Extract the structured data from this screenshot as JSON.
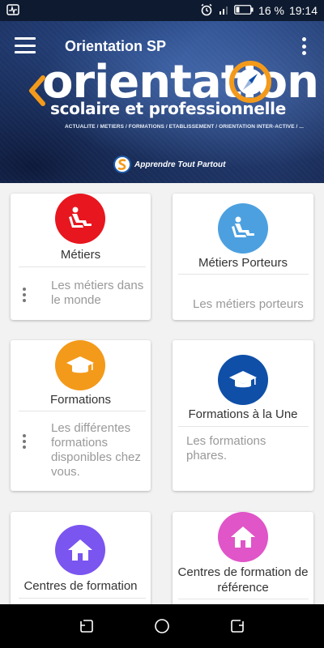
{
  "status_bar": {
    "battery_text": "16 %",
    "time": "19:14",
    "icons": [
      "activity-icon",
      "alarm-icon",
      "signal-icon",
      "battery-icon"
    ]
  },
  "toolbar": {
    "title": "Orientation SP",
    "menu_icon": "hamburger-menu-icon",
    "more_icon": "overflow-menu-icon"
  },
  "banner": {
    "title": "orientation",
    "subtitle": "scolaire et professionnelle",
    "tags": "ACTUALITE / METIERS / FORMATIONS / ETABLISSEMENT / ORIENTATION INTER-ACTIVE / ...",
    "slogan": "Apprendre Tout Partout"
  },
  "cards": [
    {
      "title": "Métiers",
      "description": "Les métiers dans le monde",
      "icon": "seat-icon",
      "color": "#e8161e",
      "has_menu": true
    },
    {
      "title": "Métiers Porteurs",
      "description": "Les métiers porteurs",
      "icon": "seat-icon",
      "color": "#4ca0e0",
      "has_menu": false
    },
    {
      "title": "Formations",
      "description": "Les différentes formations disponibles chez vous.",
      "icon": "graduation-cap-icon",
      "color": "#f39a1b",
      "has_menu": true
    },
    {
      "title": "Formations à la Une",
      "description": "Les  formations phares.",
      "icon": "graduation-cap-icon",
      "color": "#0f4fa8",
      "has_menu": false
    },
    {
      "title": "Centres de formation",
      "description": "",
      "icon": "home-icon",
      "color": "#7a55f0",
      "has_menu": false
    },
    {
      "title": "Centres de formation de référence",
      "description": "",
      "icon": "home-icon",
      "color": "#e055c8",
      "has_menu": false
    }
  ],
  "nav_bar": {
    "icons": [
      "recents-icon",
      "home-circle-icon",
      "back-icon"
    ]
  }
}
